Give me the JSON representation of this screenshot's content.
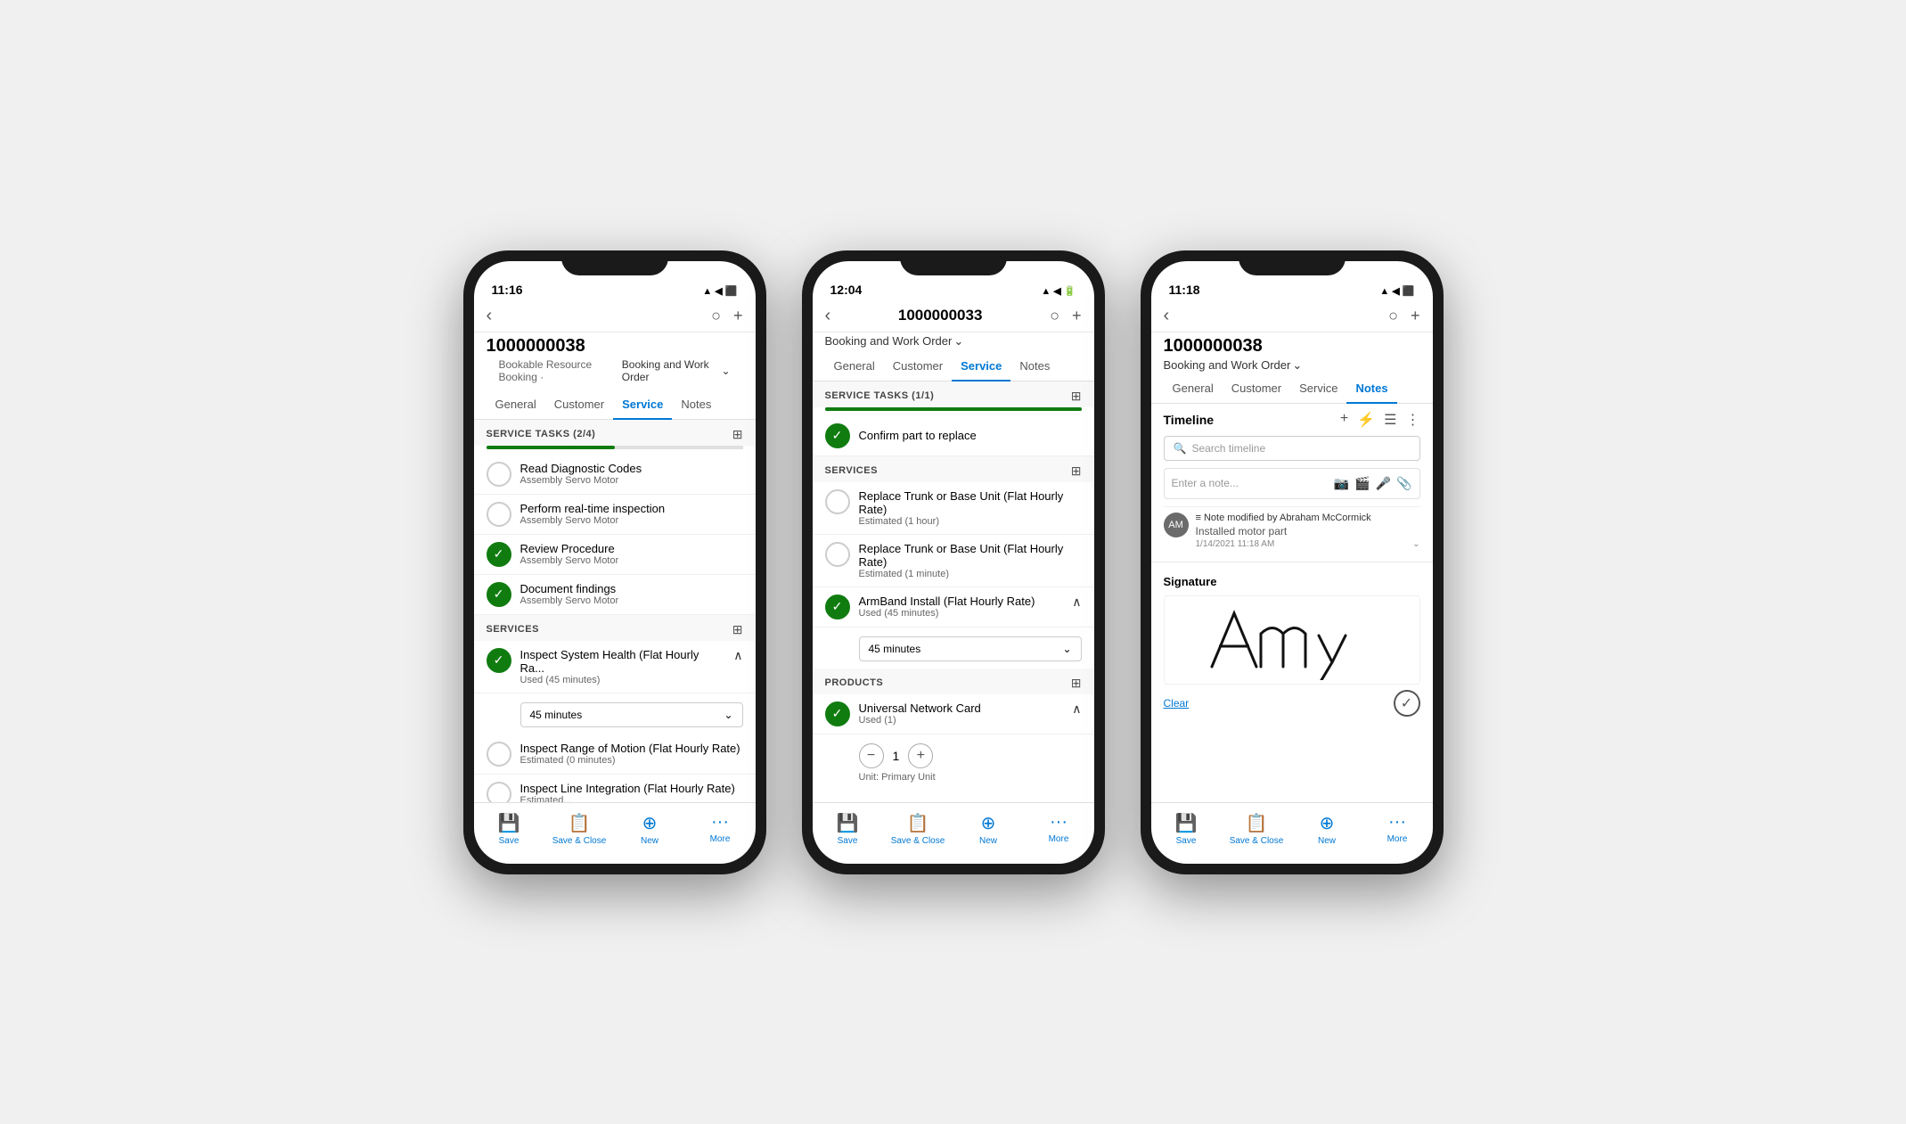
{
  "scene": {
    "background": "#f0f0f0"
  },
  "phone1": {
    "status": {
      "time": "11:16",
      "signal": "▲",
      "wifi": "WiFi",
      "battery": "🔋"
    },
    "title": "1000000038",
    "subtitle1": "Bookable Resource Booking ·",
    "subtitle2": "Booking and Work Order",
    "tabs": [
      "General",
      "Customer",
      "Service",
      "Notes"
    ],
    "active_tab": "Service",
    "section1_title": "SERVICE TASKS (2/4)",
    "section1_progress": 50,
    "tasks": [
      {
        "name": "Read Diagnostic Codes",
        "sub": "Assembly Servo Motor",
        "done": false
      },
      {
        "name": "Perform real-time inspection",
        "sub": "Assembly Servo Motor",
        "done": false
      },
      {
        "name": "Review Procedure",
        "sub": "Assembly Servo Motor",
        "done": true
      },
      {
        "name": "Document findings",
        "sub": "Assembly Servo Motor",
        "done": true
      }
    ],
    "section2_title": "SERVICES",
    "services": [
      {
        "name": "Inspect System Health (Flat Hourly Ra...",
        "sub": "Used (45 minutes)",
        "done": true,
        "expanded": true,
        "dropdown": "45 minutes"
      },
      {
        "name": "Inspect Range of Motion (Flat Hourly Rate)",
        "sub": "Estimated (0 minutes)",
        "done": false,
        "expanded": false
      },
      {
        "name": "Inspect Line Integration (Flat Hourly Rate)",
        "sub": "Estimated...",
        "done": false,
        "expanded": false
      }
    ],
    "toolbar": {
      "save": "Save",
      "save_close": "Save & Close",
      "new": "New",
      "more": "More"
    }
  },
  "phone2": {
    "status": {
      "time": "12:04",
      "battery_charging": true
    },
    "title": "1000000033",
    "subtitle": "Booking and Work Order",
    "tabs": [
      "General",
      "Customer",
      "Service",
      "Notes"
    ],
    "active_tab": "Service",
    "section1_title": "SERVICE TASKS (1/1)",
    "section1_progress": 100,
    "tasks": [
      {
        "name": "Confirm part to replace",
        "done": true
      }
    ],
    "section2_title": "SERVICES",
    "services": [
      {
        "name": "Replace Trunk or Base Unit (Flat Hourly Rate)",
        "sub": "Estimated (1 hour)",
        "done": false
      },
      {
        "name": "Replace Trunk or Base Unit (Flat Hourly Rate)",
        "sub": "Estimated (1 minute)",
        "done": false
      },
      {
        "name": "ArmBand Install (Flat Hourly Rate)",
        "sub": "Used (45 minutes)",
        "done": true,
        "expanded": true,
        "dropdown": "45 minutes"
      }
    ],
    "section3_title": "PRODUCTS",
    "products": [
      {
        "name": "Universal Network Card",
        "sub": "Used (1)",
        "done": true,
        "expanded": true,
        "qty": "1",
        "unit": "Unit: Primary Unit"
      }
    ],
    "toolbar": {
      "save": "Save",
      "save_close": "Save & Close",
      "new": "New",
      "more": "More"
    }
  },
  "phone3": {
    "status": {
      "time": "11:18"
    },
    "title": "1000000038",
    "subtitle": "Booking and Work Order",
    "tabs": [
      "General",
      "Customer",
      "Service",
      "Notes"
    ],
    "active_tab": "Notes",
    "timeline_title": "Timeline",
    "search_placeholder": "Search timeline",
    "note_placeholder": "Enter a note...",
    "note": {
      "author": "Note modified by Abraham McCormick",
      "text": "Installed motor part",
      "time": "1/14/2021 11:18 AM"
    },
    "signature_title": "Signature",
    "signature_clear": "Clear",
    "toolbar": {
      "save": "Save",
      "save_close": "Save & Close",
      "new": "New",
      "more": "More"
    }
  }
}
